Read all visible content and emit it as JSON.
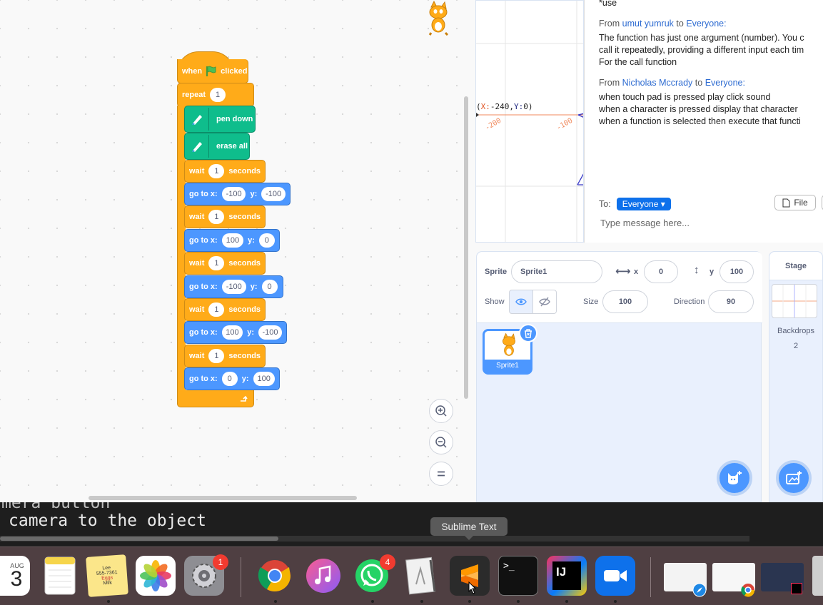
{
  "code": {
    "hat_when": "when",
    "hat_clicked": "clicked",
    "repeat_label": "repeat",
    "repeat_count": "1",
    "pen_down": "pen down",
    "erase_all": "erase all",
    "wait_label": "wait",
    "seconds_label": "seconds",
    "goto_label": "go to x:",
    "y_label": "y:",
    "waits": [
      "1",
      "1",
      "1",
      "1",
      "1"
    ],
    "gotos": [
      {
        "x": "-100",
        "y": "-100"
      },
      {
        "x": "100",
        "y": "0"
      },
      {
        "x": "-100",
        "y": "0"
      },
      {
        "x": "100",
        "y": "-100"
      },
      {
        "x": "0",
        "y": "100"
      }
    ],
    "zoom_in_icon": "zoom-in-icon",
    "zoom_out_icon": "zoom-out-icon",
    "zoom_reset_icon": "zoom-reset-icon"
  },
  "stage": {
    "coord_prefix": "(",
    "coord_x_label": "X:",
    "coord_x": "-240",
    "coord_sep": ",",
    "coord_y_label": "Y:",
    "coord_y": "0",
    "coord_suffix": ")",
    "tick_1": "-200",
    "tick_2": "-100"
  },
  "chat": {
    "top_fragment": "*use",
    "messages": [
      {
        "from_prefix": "From",
        "sender": "umut yumruk",
        "to_word": "to",
        "recipient": "Everyone:",
        "lines": [
          "The function has just one argument (number). You c",
          "call it repeatedly, providing a different input each tim",
          "For the call function"
        ]
      },
      {
        "from_prefix": "From",
        "sender": "Nicholas Mccrady",
        "to_word": "to",
        "recipient": "Everyone:",
        "lines": [
          "when touch pad is pressed play click sound",
          "when a character is pressed display that character",
          "when a function is selected then execute that functi"
        ]
      }
    ],
    "to_label": "To:",
    "to_value": "Everyone",
    "file_label": "File",
    "input_placeholder": "Type message here..."
  },
  "sprite": {
    "sprite_label": "Sprite",
    "sprite_name": "Sprite1",
    "x_label": "x",
    "x_value": "0",
    "y_label": "y",
    "y_value": "100",
    "show_label": "Show",
    "size_label": "Size",
    "size_value": "100",
    "direction_label": "Direction",
    "direction_value": "90",
    "tile_name": "Sprite1"
  },
  "stage_selector": {
    "title": "Stage",
    "backdrops_label": "Backdrops",
    "backdrops_count": "2"
  },
  "terminal": {
    "line1": "mera button",
    "line2": "camera to the object"
  },
  "dock": {
    "tooltip": "Sublime Text",
    "calendar_month": "AUG",
    "calendar_day": "3",
    "system_prefs_badge": "1",
    "whatsapp_badge": "4",
    "terminal_glyph": ">_",
    "intellij_glyph": "IJ",
    "notes_text_1": "Lee",
    "notes_text_2": "555-7361",
    "notes_text_3": "Eggs",
    "notes_text_4": "Milk"
  },
  "colors": {
    "motion_blue": "#4c97ff",
    "control_orange": "#ffab19",
    "pen_green": "#0fbd8c",
    "zoom_blue": "#0e71eb",
    "dock_bg": "#4f3f42"
  }
}
